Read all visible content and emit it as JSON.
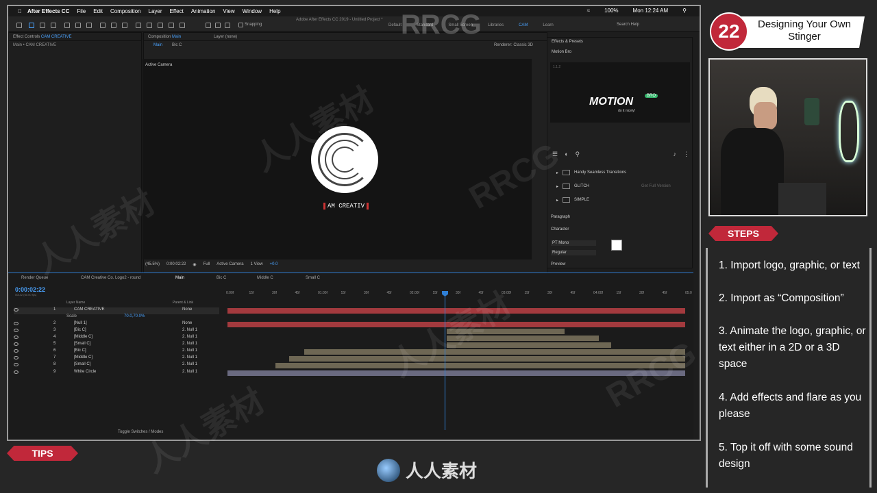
{
  "menubar": {
    "app_name": "After Effects CC",
    "items": [
      "File",
      "Edit",
      "Composition",
      "Layer",
      "Effect",
      "Animation",
      "View",
      "Window",
      "Help"
    ],
    "battery": "100%",
    "clock": "Mon 12:24 AM"
  },
  "toolbar": {
    "window_title": "Adobe After Effects CC 2019 - Untitled Project *",
    "snapping": "Snapping",
    "workspaces": [
      "Default",
      "Standard",
      "Small Screen",
      "Libraries",
      "CAM",
      "Learn"
    ],
    "active_workspace": "CAM",
    "search_placeholder": "Search Help"
  },
  "left_panel": {
    "tab": "Effect Controls",
    "tab_target": "CAM CREATIVE",
    "crumb": "Main • CAM CREATIVE"
  },
  "composition": {
    "tab": "Composition",
    "tab_target": "Main",
    "layer_tab": "Layer (none)",
    "subtabs": [
      "Main",
      "Bic C"
    ],
    "renderer_label": "Renderer:",
    "renderer": "Classic 3D",
    "view_label": "Active Camera",
    "logo_text": "AM CREATIV",
    "zoom": "(45.5%)",
    "timecode": "0:00:02:22",
    "resolution": "Full",
    "camera": "Active Camera",
    "views": "1 View",
    "exposure": "+0.0"
  },
  "effects_panel": {
    "title": "Effects & Presets",
    "plugin_title": "Motion Bro",
    "version": "1.1.2",
    "brand": "MOTION",
    "brand_badge": "BRO",
    "tagline": "do it nicely!",
    "folders": [
      {
        "name": "Handy Seamless Transitions",
        "note": ""
      },
      {
        "name": "GLITCH",
        "note": "Get Full Version"
      },
      {
        "name": "SIMPLE",
        "note": ""
      }
    ],
    "paragraph": "Paragraph",
    "character": "Character",
    "font": "PT Mono",
    "style": "Regular",
    "preview": "Preview"
  },
  "timeline": {
    "tabs": [
      "Render Queue",
      "CAM Creative Co. Logo2 - round",
      "Main",
      "Bic C",
      "Middle C",
      "Small C"
    ],
    "active_tab": "Main",
    "timecode": "0:00:02:22",
    "fps": "00142 (60.00 fps)",
    "col_layer_name": "Layer Name",
    "col_parent": "Parent & Link",
    "scale_label": "Scale",
    "scale_value": "70.0,70.0%",
    "ruler": [
      "0:00f",
      "15f",
      "30f",
      "45f",
      "01:00f",
      "15f",
      "30f",
      "45f",
      "02:00f",
      "15f",
      "30f",
      "45f",
      "03:00f",
      "15f",
      "30f",
      "45f",
      "04:00f",
      "15f",
      "30f",
      "45f",
      "05:0"
    ],
    "layers": [
      {
        "num": "1",
        "name": "CAM CREATIVE",
        "parent": "None"
      },
      {
        "num": "2",
        "name": "[Null 1]",
        "parent": "None"
      },
      {
        "num": "3",
        "name": "[Bic C]",
        "parent": "2. Null 1"
      },
      {
        "num": "4",
        "name": "[Middle C]",
        "parent": "2. Null 1"
      },
      {
        "num": "5",
        "name": "[Small C]",
        "parent": "2. Null 1"
      },
      {
        "num": "6",
        "name": "[Bic C]",
        "parent": "2. Null 1"
      },
      {
        "num": "7",
        "name": "[Middle C]",
        "parent": "2. Null 1"
      },
      {
        "num": "8",
        "name": "[Small C]",
        "parent": "2. Null 1"
      },
      {
        "num": "9",
        "name": "White Circle",
        "parent": "2. Null 1"
      }
    ],
    "footer": "Toggle Switches / Modes"
  },
  "overlay": {
    "step_number": "22",
    "title": "Designing Your Own Stinger",
    "steps_banner": "STEPS",
    "tips_banner": "TIPS",
    "steps": [
      "1. Import logo, graphic, or text",
      "2. Import as “Composition”",
      "3. Animate the logo, graphic, or text either in a 2D or a 3D space",
      "4. Add effects and flare as you please",
      "5. Top it off with some sound design"
    ],
    "watermark_latin": "RRCG",
    "watermark_cjk": "人人素材",
    "bottom_brand": "人人素材"
  },
  "colors": {
    "accent_red": "#c1283a",
    "ae_blue": "#4aa3ff",
    "layer_red": "#a33a3e",
    "layer_tan": "#6e6754",
    "layer_purple": "#6a6a80"
  }
}
